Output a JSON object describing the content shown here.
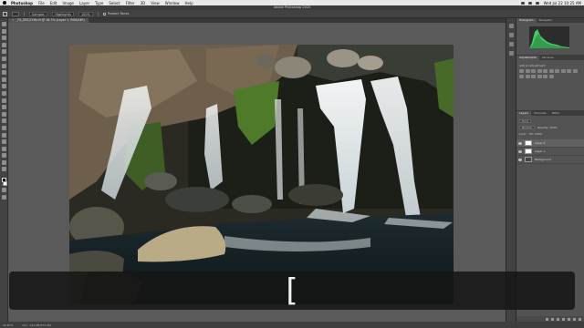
{
  "menubar": {
    "app_name": "Photoshop",
    "items": [
      "File",
      "Edit",
      "Image",
      "Layer",
      "Type",
      "Select",
      "Filter",
      "3D",
      "View",
      "Window",
      "Help"
    ],
    "clock": "Wed Jul 22 10:25 AM"
  },
  "window": {
    "title": "Adobe Photoshop 2020"
  },
  "options_bar": {
    "fields": [
      "Sample:",
      "Highlights",
      "100%"
    ],
    "protect_tones_label": "Protect Tones"
  },
  "document": {
    "tab_label": "_FS_DSC2336.tif @ 16.7% (Layer 1, RGB/16*)"
  },
  "panels": {
    "histogram": {
      "tabs": [
        "Histogram",
        "Navigator"
      ]
    },
    "adjustments": {
      "tabs": [
        "Adjustments",
        "Libraries"
      ],
      "subtitle": "Add an adjustment"
    },
    "layers": {
      "tabs": [
        "Layers",
        "Channels",
        "Paths"
      ],
      "kind_label": "Kind",
      "blend_mode": "Normal",
      "opacity": "Opacity: 100%",
      "lock_label": "Lock:",
      "fill": "Fill: 100%",
      "rows": [
        {
          "name": "Layer 2",
          "image": false,
          "selected": true
        },
        {
          "name": "Layer 1",
          "image": false,
          "selected": false
        },
        {
          "name": "Background",
          "image": true,
          "selected": false
        }
      ]
    }
  },
  "status": {
    "zoom": "16.67%",
    "doc_info": "Doc: 143.4M/373.2M"
  },
  "overlay": {
    "key": "["
  },
  "colors": {
    "accent_histogram": "#4fd86e",
    "overlay_bg": "#161616"
  }
}
